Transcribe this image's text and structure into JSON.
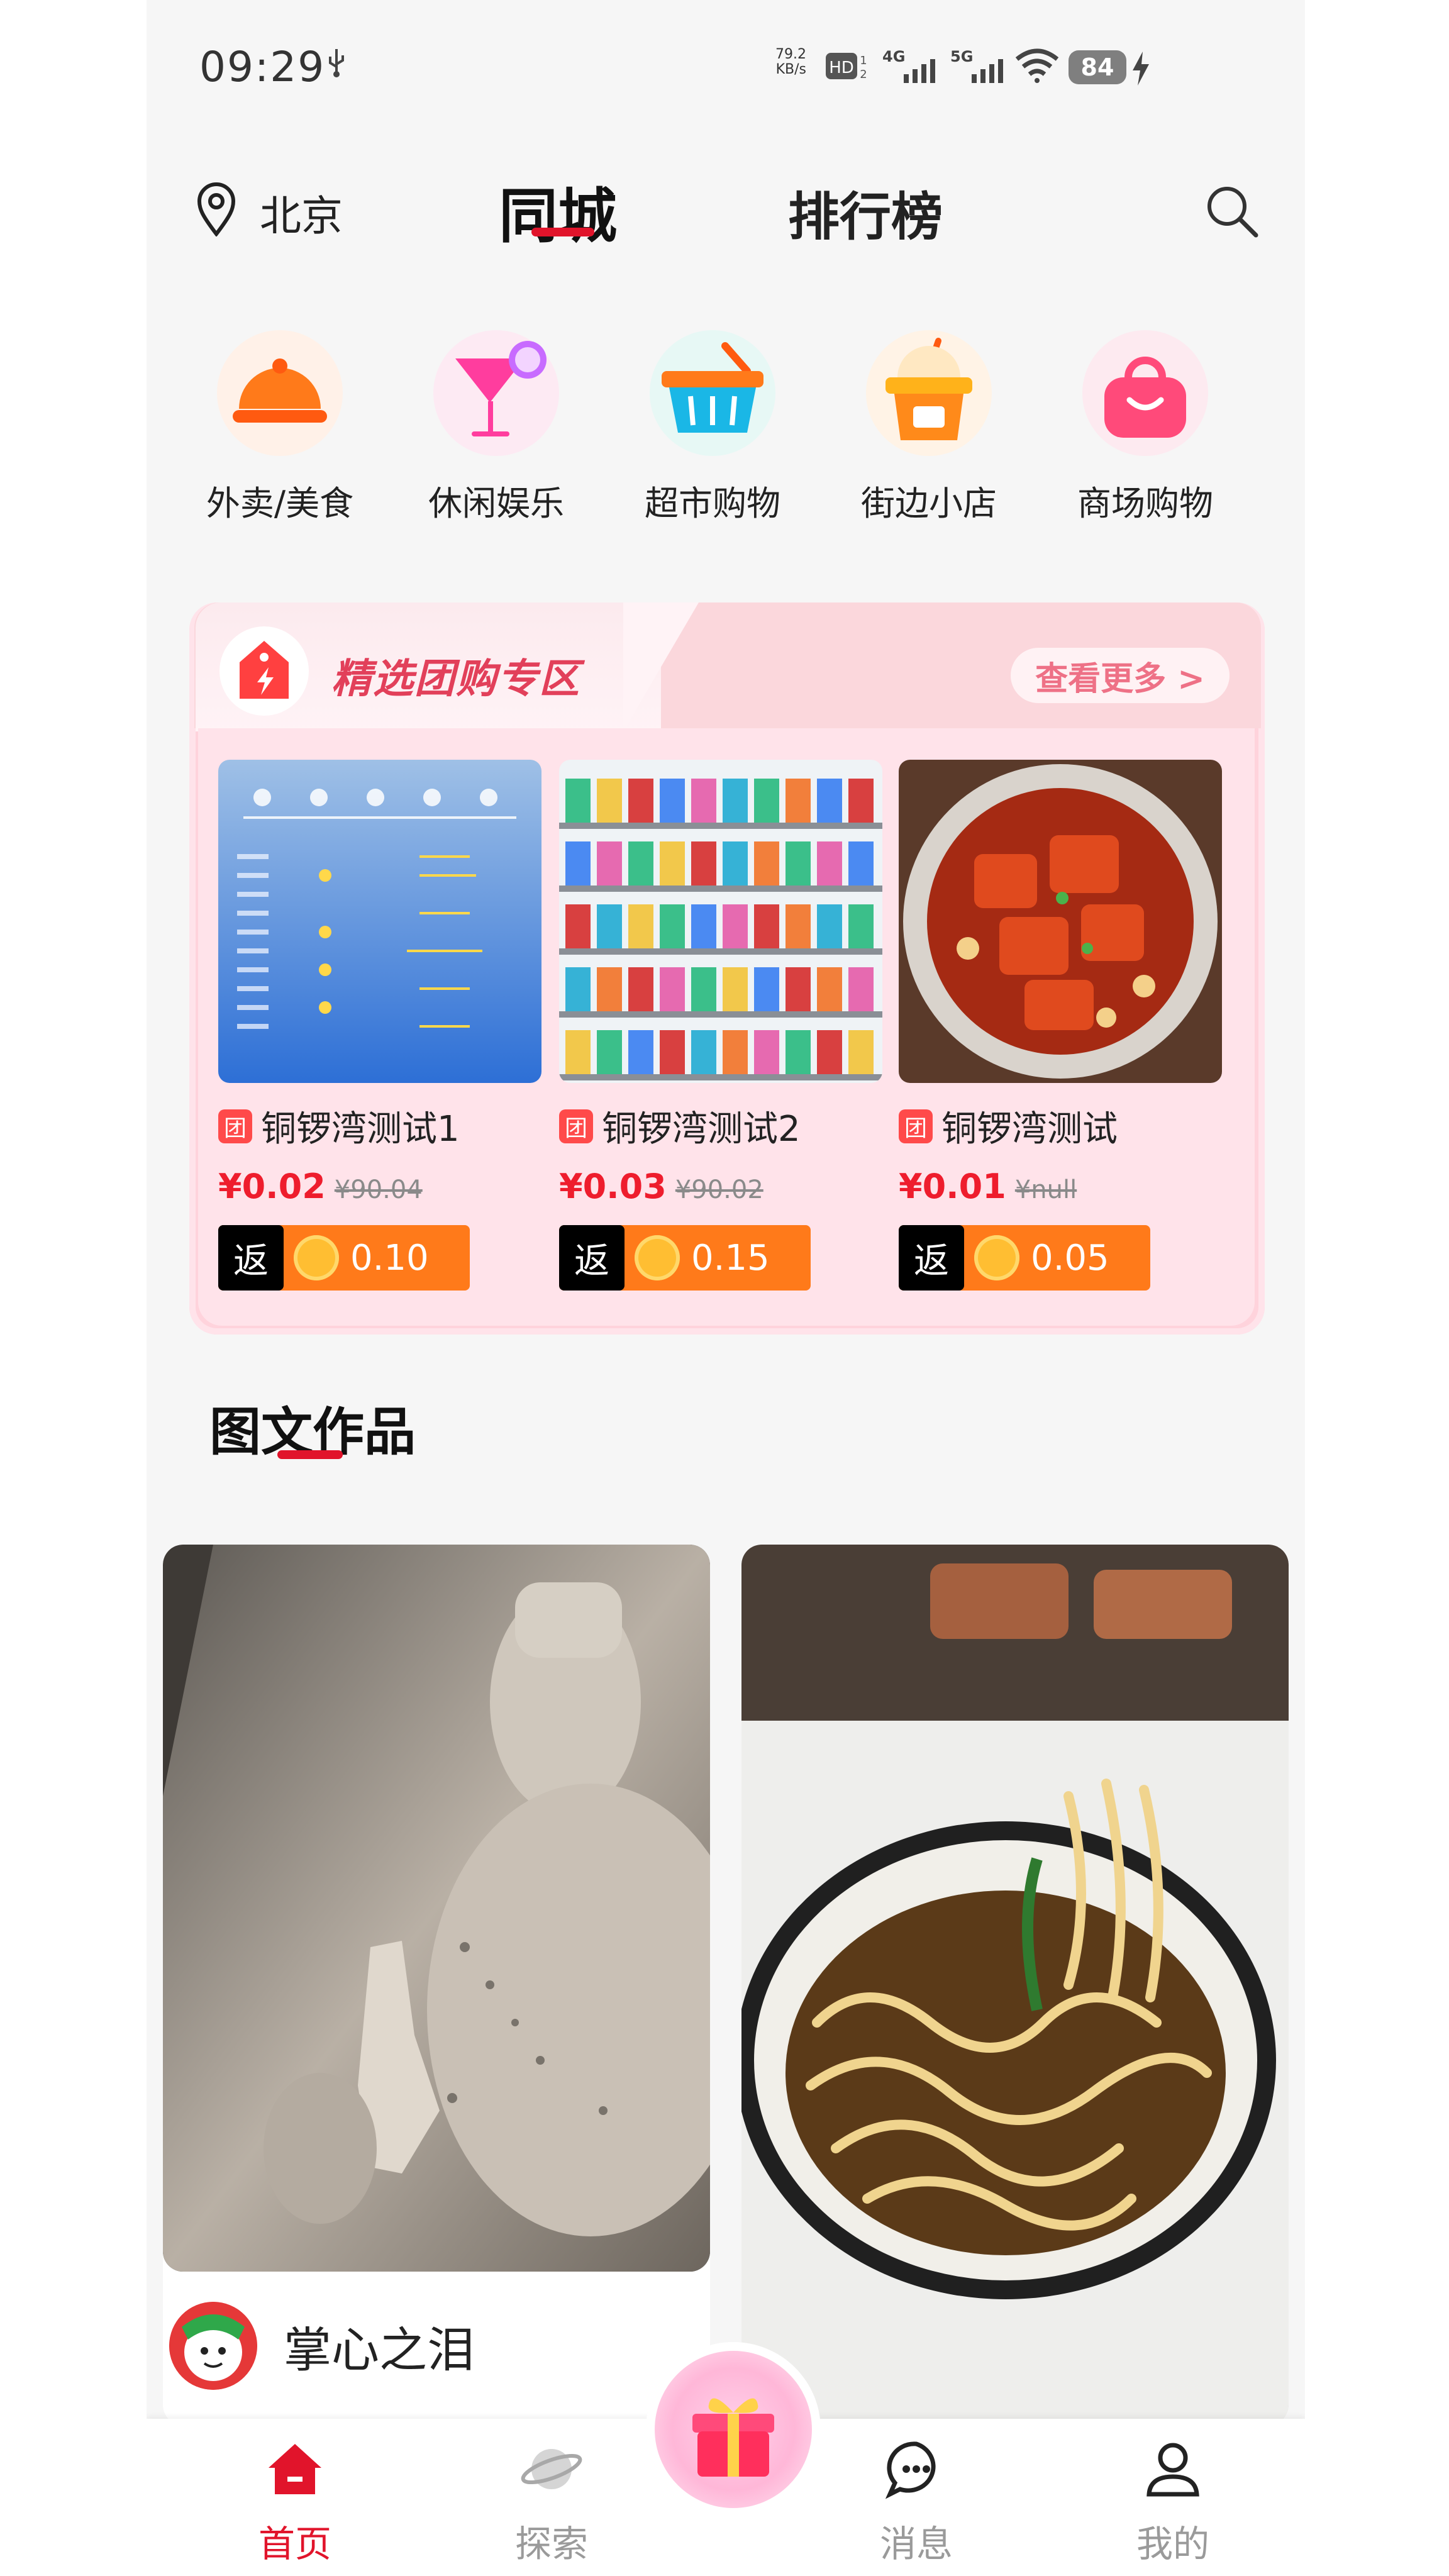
{
  "status": {
    "time": "09:29",
    "net_speed": "79.2",
    "net_unit": "KB/s",
    "battery": "84",
    "hd": "HD",
    "sig1": "4G",
    "sig2": "5G"
  },
  "header": {
    "location": "北京",
    "tab_city": "同城",
    "tab_rank": "排行榜"
  },
  "categories": [
    {
      "label": "外卖/美食",
      "icon": "food-tray-icon"
    },
    {
      "label": "休闲娱乐",
      "icon": "cocktail-icon"
    },
    {
      "label": "超市购物",
      "icon": "basket-icon"
    },
    {
      "label": "街边小店",
      "icon": "drink-icon"
    },
    {
      "label": "商场购物",
      "icon": "bag-icon"
    }
  ],
  "group_buy": {
    "title": "精选团购专区",
    "more": "查看更多 >",
    "items": [
      {
        "tag": "团",
        "name": "铜锣湾测试1",
        "price": "¥0.02",
        "orig": "¥90.04",
        "rebate_label": "返",
        "rebate": "0.10",
        "img": "weather-screenshot"
      },
      {
        "tag": "团",
        "name": "铜锣湾测试2",
        "price": "¥0.03",
        "orig": "¥90.02",
        "rebate_label": "返",
        "rebate": "0.15",
        "img": "supermarket-shelves"
      },
      {
        "tag": "团",
        "name": "铜锣湾测试",
        "price": "¥0.01",
        "orig": "¥null",
        "rebate_label": "返",
        "rebate": "0.05",
        "img": "braised-pork"
      }
    ]
  },
  "section": {
    "title": "图文作品"
  },
  "feed": [
    {
      "img": "buddha-statue",
      "user": "掌心之泪"
    },
    {
      "img": "noodle-bowl",
      "user": ""
    }
  ],
  "nav": [
    {
      "label": "首页",
      "active": true
    },
    {
      "label": "探索",
      "active": false
    },
    {
      "label": "消息",
      "active": false
    },
    {
      "label": "我的",
      "active": false
    }
  ],
  "colors": {
    "brand_red": "#e1142b",
    "pink": "#ffd3dc",
    "orange": "#ff7a1a"
  }
}
